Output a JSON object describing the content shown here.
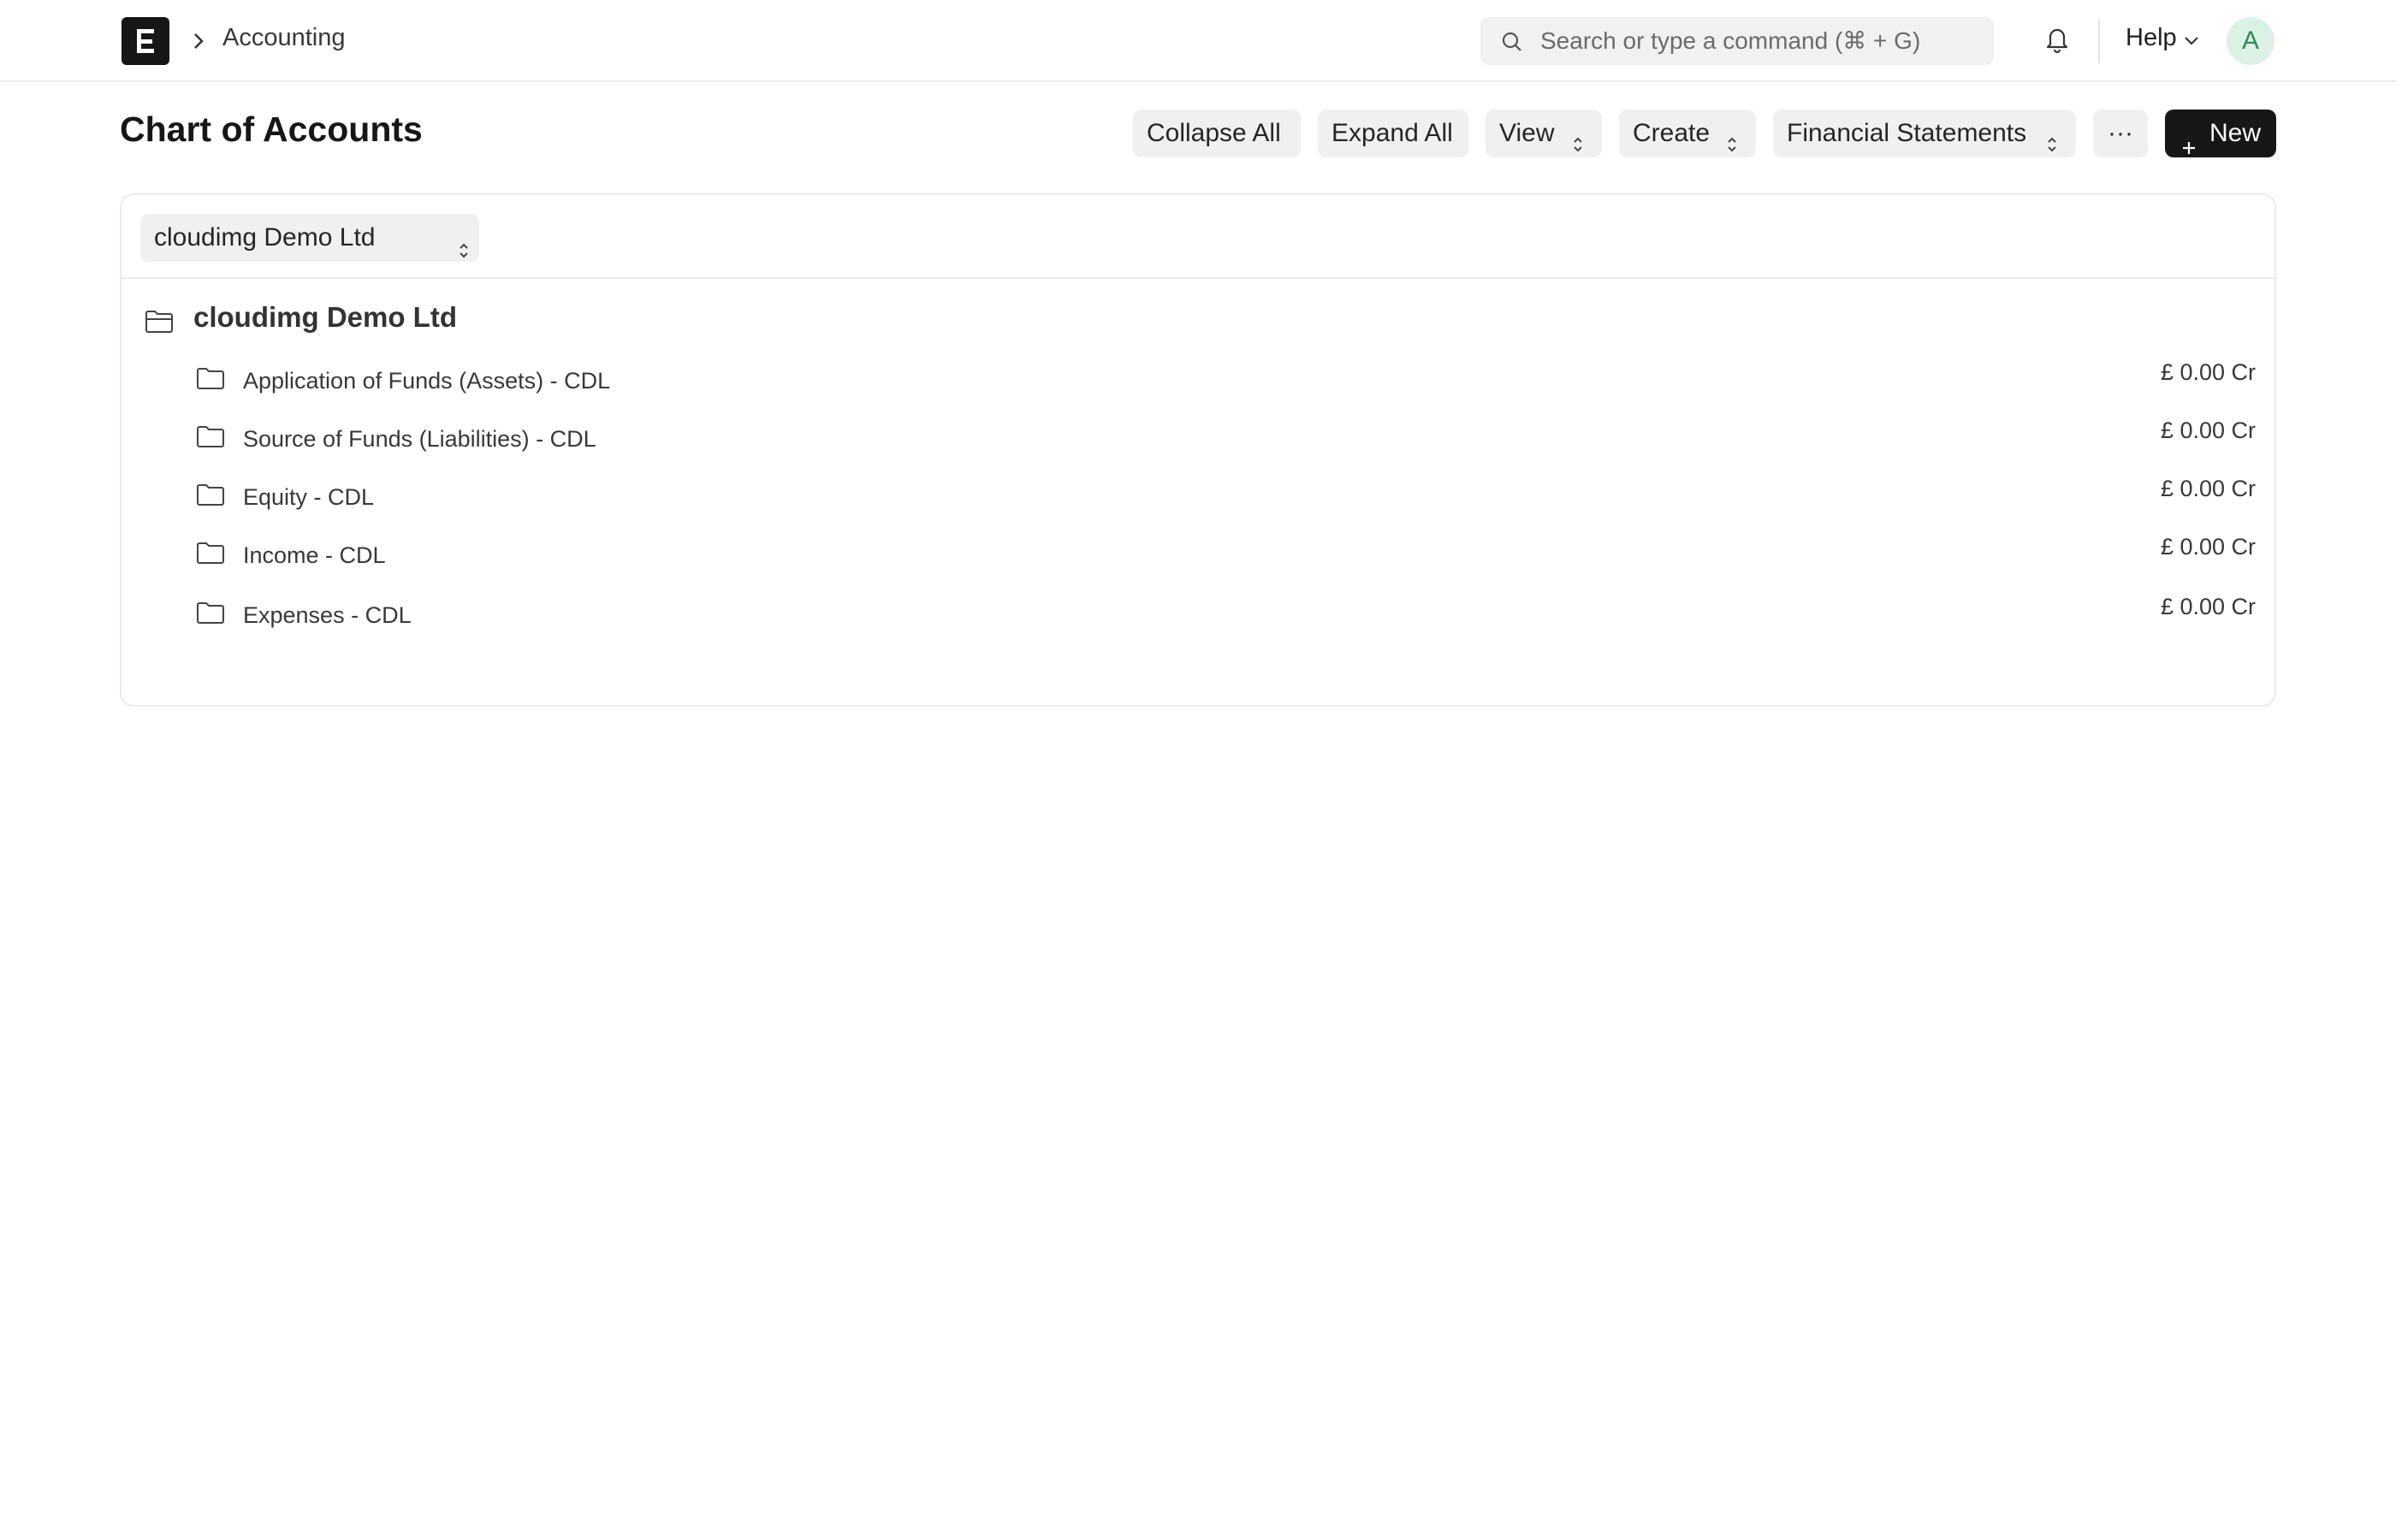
{
  "navbar": {
    "breadcrumb": "Accounting",
    "search": {
      "placeholder": "Search or type a command (⌘ + G)"
    },
    "help_label": "Help",
    "avatar_initial": "A"
  },
  "page": {
    "title": "Chart of Accounts",
    "toolbar": {
      "collapse_all": "Collapse All",
      "expand_all": "Expand All",
      "view": "View",
      "create": "Create",
      "financial_statements": "Financial Statements",
      "more": "···",
      "new": "New"
    }
  },
  "filter": {
    "company": "cloudimg Demo Ltd"
  },
  "tree": {
    "root": "cloudimg Demo Ltd",
    "items": [
      {
        "label": "Application of Funds (Assets) - CDL",
        "amount": "£ 0.00 Cr"
      },
      {
        "label": "Source of Funds (Liabilities) - CDL",
        "amount": "£ 0.00 Cr"
      },
      {
        "label": "Equity - CDL",
        "amount": "£ 0.00 Cr"
      },
      {
        "label": "Income - CDL",
        "amount": "£ 0.00 Cr"
      },
      {
        "label": "Expenses - CDL",
        "amount": "£ 0.00 Cr"
      }
    ]
  },
  "colors": {
    "primary_button": "#171717",
    "avatar_bg": "#dcf2e4",
    "avatar_text": "#2e8b57",
    "button_bg": "#f0f0f0"
  },
  "icons": [
    "app-logo-icon",
    "chevron-right-icon",
    "search-icon",
    "bell-icon",
    "chevron-down-icon",
    "updown-icon",
    "plus-icon",
    "folder-open-icon",
    "folder-icon"
  ]
}
